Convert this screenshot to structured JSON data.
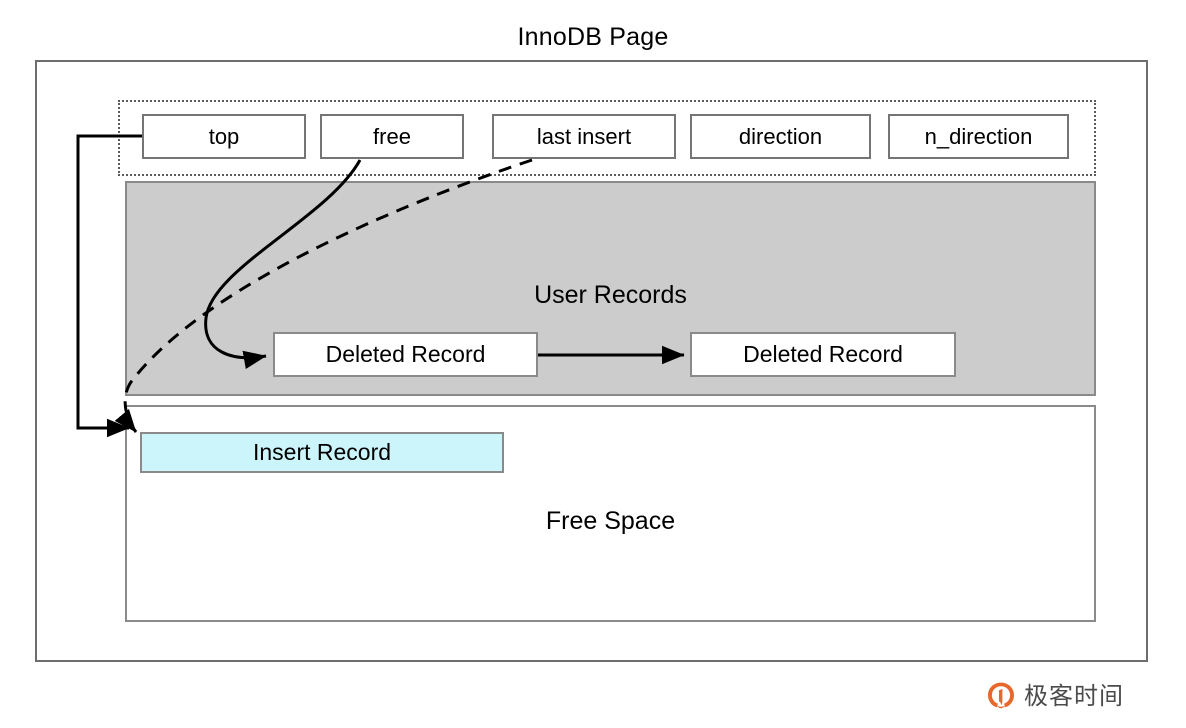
{
  "diagram": {
    "title": "InnoDB Page",
    "header_fields": [
      {
        "id": "top",
        "label": "top"
      },
      {
        "id": "free",
        "label": "free"
      },
      {
        "id": "last_insert",
        "label": "last insert"
      },
      {
        "id": "direction",
        "label": "direction"
      },
      {
        "id": "n_direction",
        "label": "n_direction"
      }
    ],
    "regions": {
      "user_records": {
        "label": "User Records",
        "fill_color": "#cccccc",
        "records": [
          {
            "id": "deleted_1",
            "label": "Deleted Record"
          },
          {
            "id": "deleted_2",
            "label": "Deleted Record"
          }
        ]
      },
      "free_space": {
        "label": "Free Space",
        "fill_color": "#ffffff",
        "records": [
          {
            "id": "insert_1",
            "label": "Insert Record",
            "fill_color": "#cbf5fb"
          }
        ]
      }
    },
    "connectors": [
      {
        "id": "top-to-free-space",
        "from": "top",
        "to": "free_space",
        "style": "solid",
        "arrow": true
      },
      {
        "id": "free-to-deleted-record",
        "from": "free",
        "to": "deleted_1",
        "style": "solid",
        "arrow": true
      },
      {
        "id": "last-insert-to-insert",
        "from": "last_insert",
        "to": "insert_1",
        "style": "dashed",
        "arrow": true
      },
      {
        "id": "deleted-1-to-deleted-2",
        "from": "deleted_1",
        "to": "deleted_2",
        "style": "solid",
        "arrow": true
      }
    ],
    "border_color": "#6d6d6d",
    "box_border_color": "#8a8a8a"
  },
  "watermark": {
    "text": "极客时间",
    "logo_icon": "geektime-logo-icon",
    "logo_color": "#e8682c"
  }
}
